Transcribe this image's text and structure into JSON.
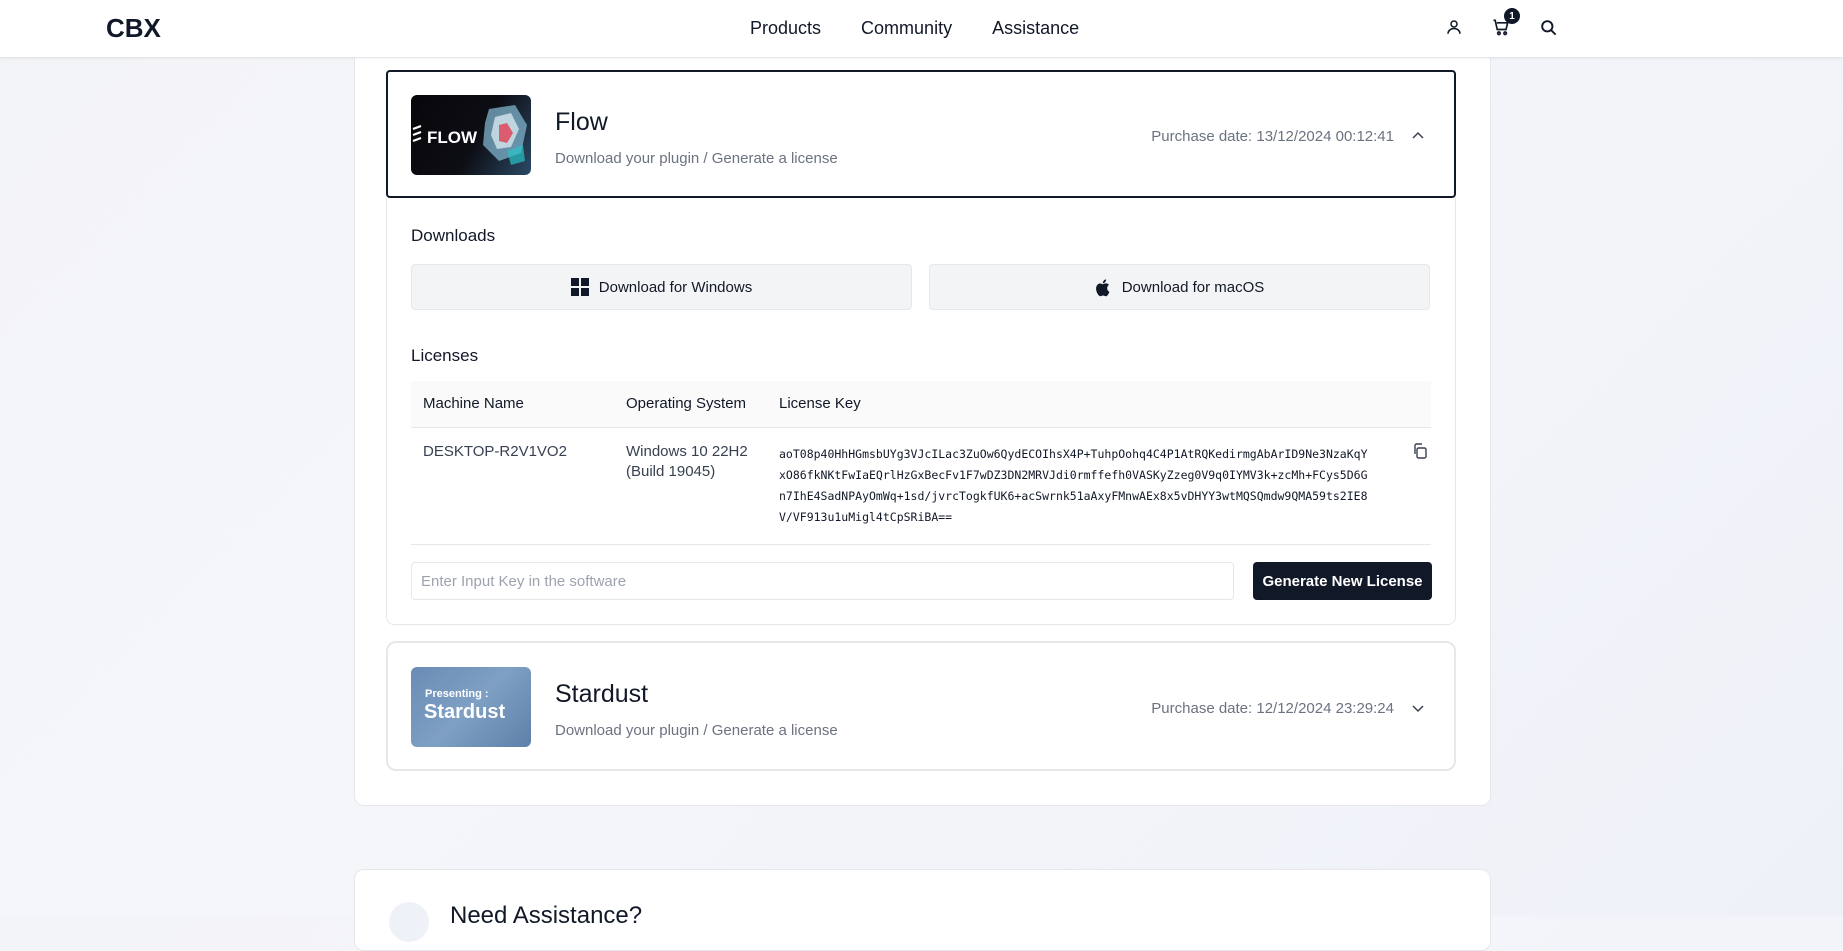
{
  "header": {
    "logo_text": "CBX",
    "nav": [
      "Products",
      "Community",
      "Assistance"
    ],
    "cart_count": "1",
    "icons": [
      "user-icon",
      "cart-icon",
      "search-icon"
    ]
  },
  "products": [
    {
      "name": "Flow",
      "thumb_text": "FLOW",
      "subtitle": "Download your plugin / Generate a license",
      "purchase_date": "Purchase date: 13/12/2024 00:12:41",
      "expanded": true
    },
    {
      "name": "Stardust",
      "thumb_line1": "Presenting :",
      "thumb_line2": "Stardust",
      "subtitle": "Download your plugin / Generate a license",
      "purchase_date": "Purchase date: 12/12/2024 23:29:24",
      "expanded": false
    }
  ],
  "downloads": {
    "heading": "Downloads",
    "windows_label": "Download for Windows",
    "macos_label": "Download for macOS"
  },
  "licenses": {
    "heading": "Licenses",
    "columns": [
      "Machine Name",
      "Operating System",
      "License Key"
    ],
    "rows": [
      {
        "machine": "DESKTOP-R2V1VO2",
        "os_line1": "Windows 10 22H2",
        "os_line2": "(Build 19045)",
        "key": "aoT08p40HhHGmsbUYg3VJcILac3ZuOw6QydECOIhsX4P+TuhpOohq4C4P1AtRQKedirmgAbArID9Ne3NzaKqYxO86fkNKtFwIaEQrlHzGxBecFv1F7wDZ3DN2MRVJdi0rmffefh0VASKyZzeg0V9q0IYMV3k+zcMh+FCys5D6Gn7IhE4SadNPAyOmWq+1sd/jvrcTogkfUK6+acSwrnk51aAxyFMnwAEx8x5vDHYY3wtMQSQmdw9QMA59ts2IE8V/VF913u1uMigl4tCpSRiBA=="
      }
    ],
    "input_placeholder": "Enter Input Key in the software",
    "generate_label": "Generate New License"
  },
  "assistance": {
    "title": "Need Assistance?"
  },
  "colors": {
    "primary": "#111827",
    "muted_text": "#6b7280",
    "border": "#e5e7eb",
    "button_bg": "#f3f4f6"
  }
}
